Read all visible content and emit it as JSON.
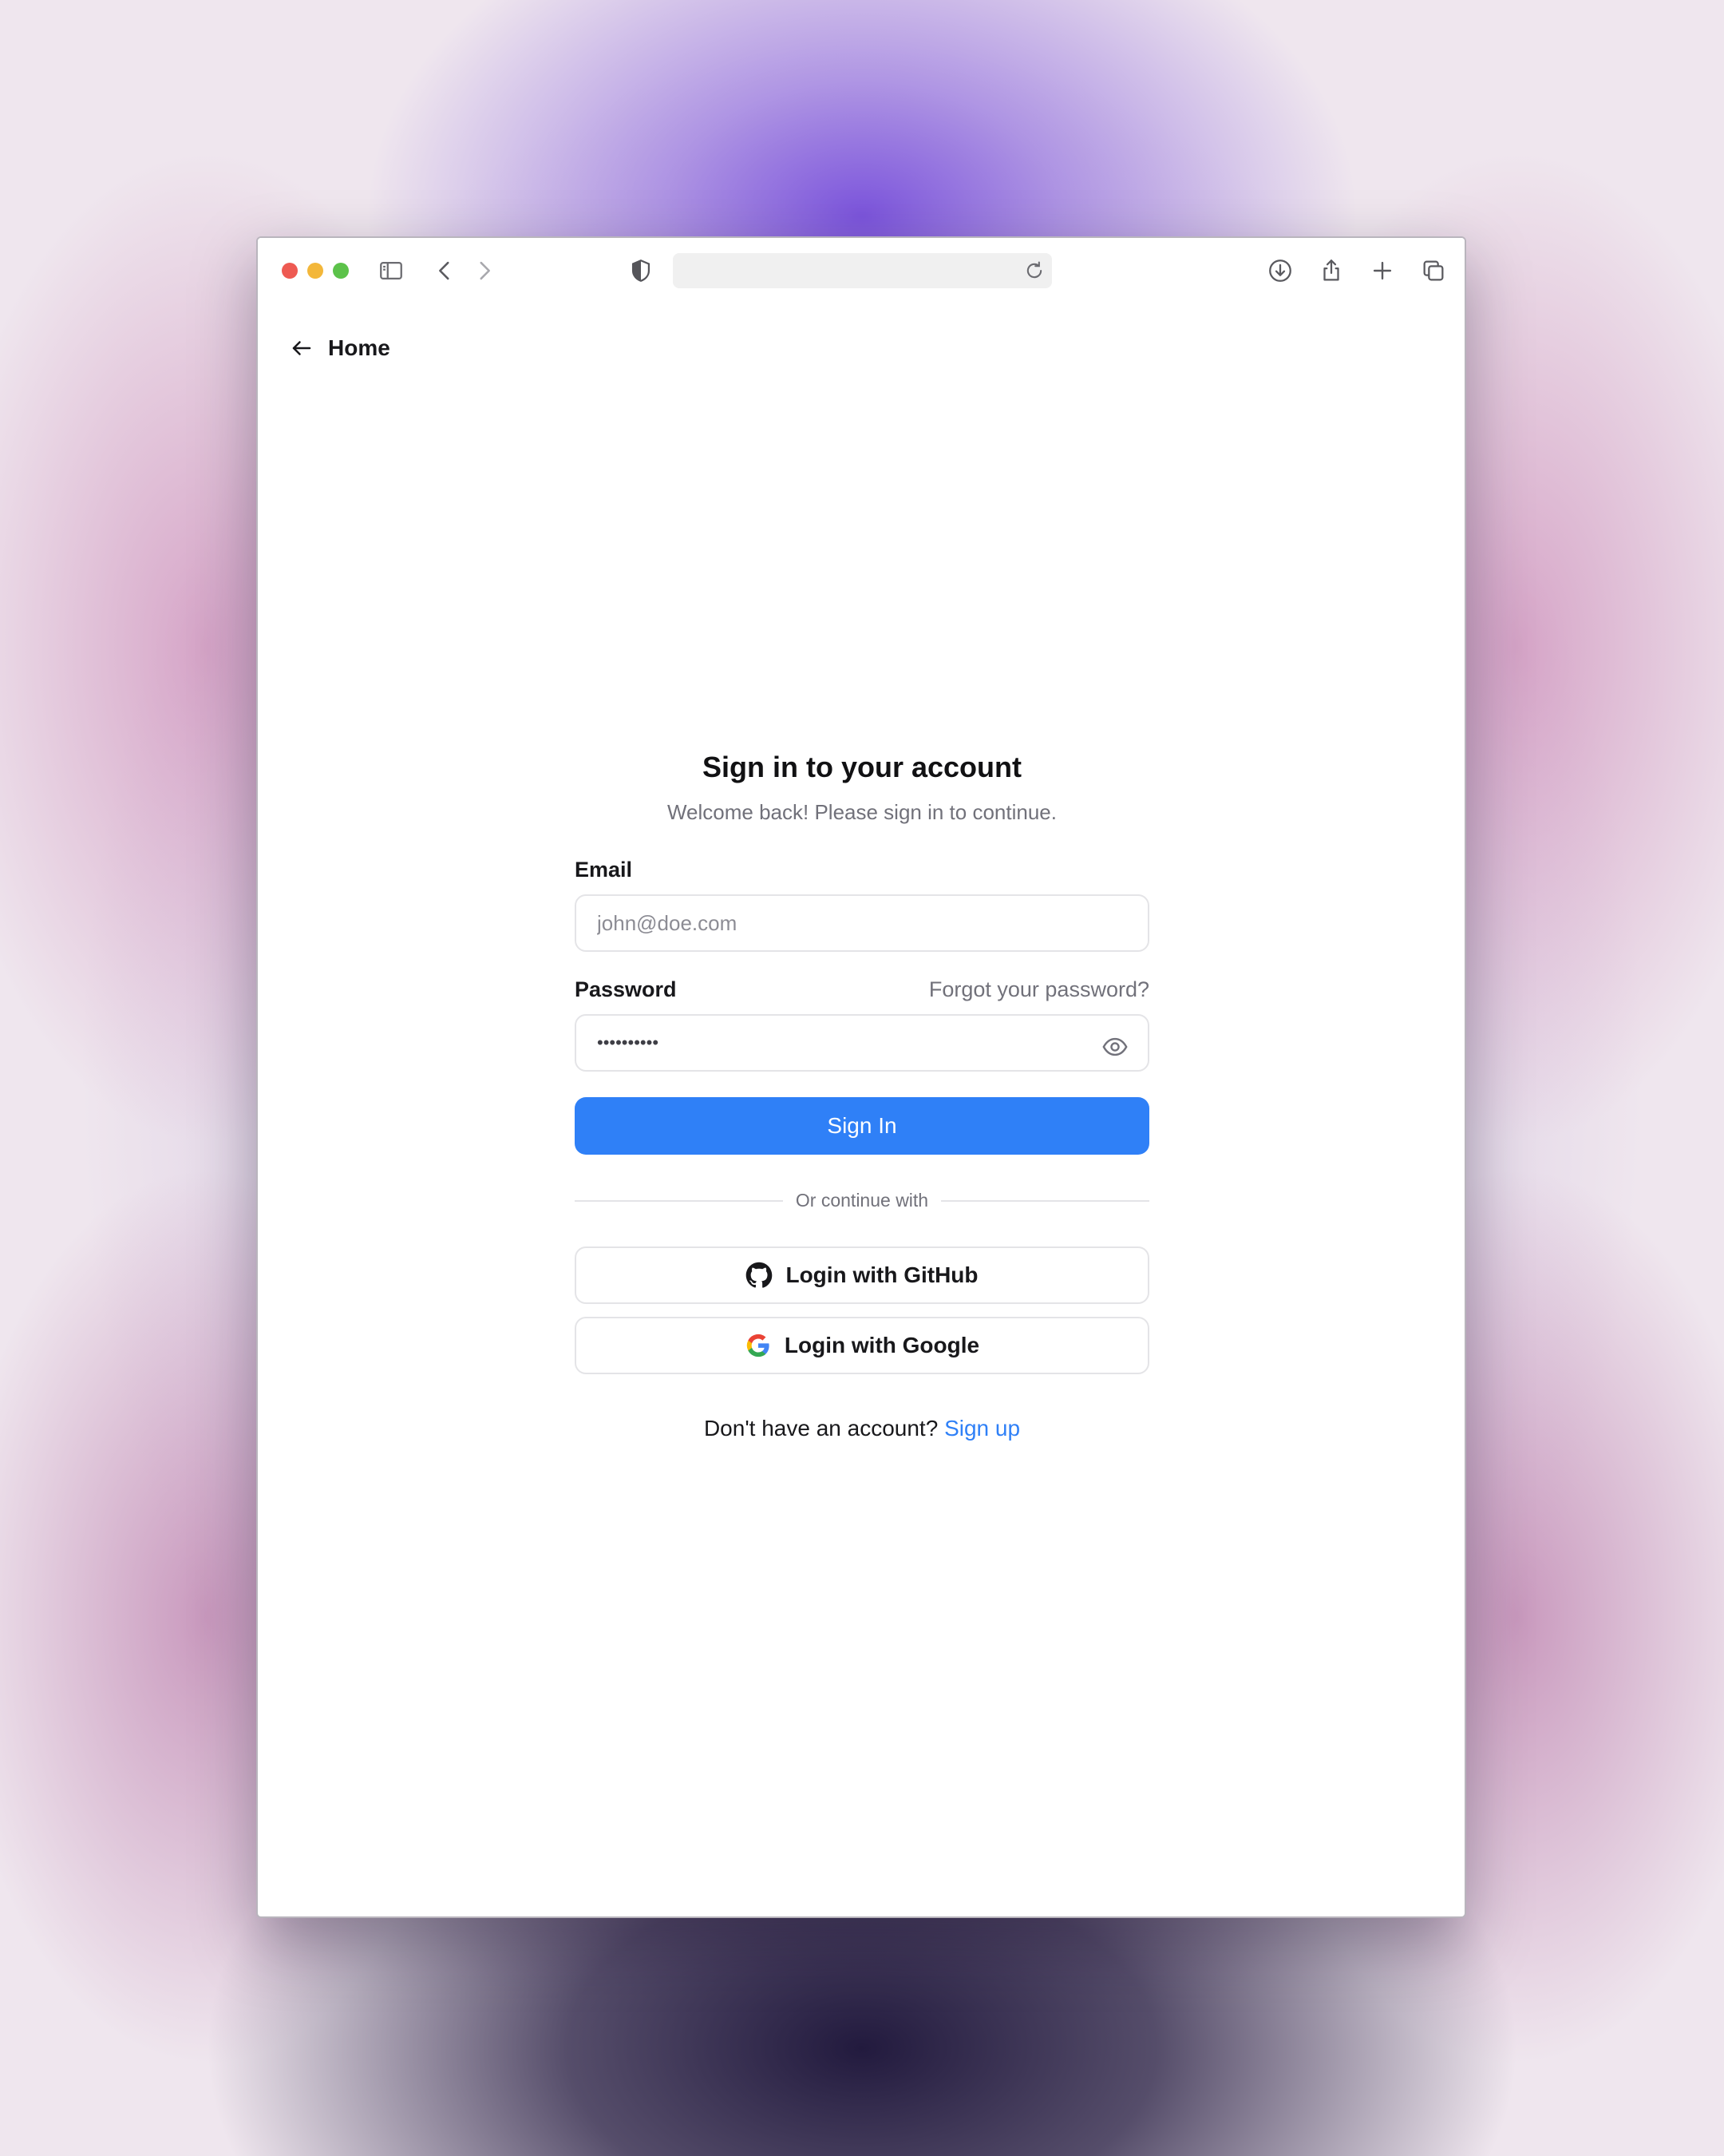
{
  "colors": {
    "accent": "#2f80f7",
    "traffic_red": "#ee5a52",
    "traffic_yellow": "#f3b73a",
    "traffic_green": "#5cc24a"
  },
  "browser": {
    "icons": [
      "sidebar-icon",
      "back-icon",
      "forward-icon",
      "shield-icon",
      "reload-icon",
      "download-icon",
      "share-icon",
      "new-tab-icon",
      "tabs-overview-icon"
    ]
  },
  "nav": {
    "home_label": "Home"
  },
  "signin": {
    "title": "Sign in to your account",
    "subtitle": "Welcome back! Please sign in to continue.",
    "email_label": "Email",
    "email_placeholder": "john@doe.com",
    "password_label": "Password",
    "forgot_label": "Forgot your password?",
    "password_mask": "••••••••••",
    "submit_label": "Sign In",
    "divider_label": "Or continue with",
    "github_label": "Login with GitHub",
    "google_label": "Login with Google",
    "signup_prompt": "Don't have an account?",
    "signup_link": "Sign up"
  }
}
